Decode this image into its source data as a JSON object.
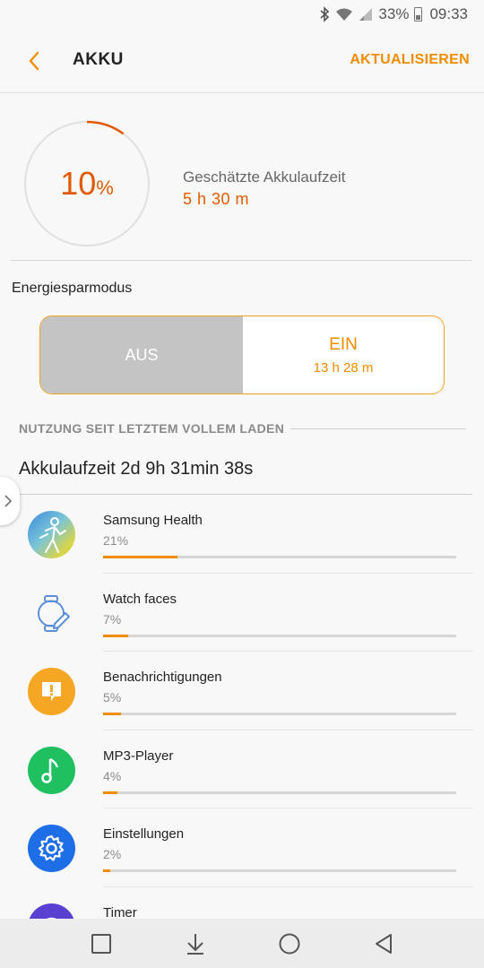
{
  "status": {
    "battery_percent": "33%",
    "time": "09:33",
    "icons": [
      "bluetooth-icon",
      "wifi-icon",
      "signal-icon",
      "battery-icon"
    ]
  },
  "header": {
    "title": "AKKU",
    "refresh_label": "AKTUALISIEREN"
  },
  "battery": {
    "level_number": "10",
    "level_unit": "%",
    "level_fraction": 0.1,
    "estimate_label": "Geschätzte Akkulaufzeit",
    "estimate_value": "5 h 30 m"
  },
  "power_saving": {
    "label": "Energiesparmodus",
    "off_label": "AUS",
    "on_label": "EIN",
    "on_time": "13 h 28 m"
  },
  "usage": {
    "section_title": "NUTZUNG SEIT LETZTEM VOLLEM LADEN",
    "uptime": "Akkulaufzeit 2d 9h 31min 38s",
    "apps": [
      {
        "name": "Samsung Health",
        "percent": "21%",
        "fraction": 0.21,
        "icon": "samsung-health-icon"
      },
      {
        "name": "Watch faces",
        "percent": "7%",
        "fraction": 0.07,
        "icon": "watch-faces-icon"
      },
      {
        "name": "Benachrichtigungen",
        "percent": "5%",
        "fraction": 0.05,
        "icon": "notification-icon"
      },
      {
        "name": "MP3-Player",
        "percent": "4%",
        "fraction": 0.04,
        "icon": "music-note-icon"
      },
      {
        "name": "Einstellungen",
        "percent": "2%",
        "fraction": 0.02,
        "icon": "settings-gear-icon"
      },
      {
        "name": "Timer",
        "percent": "",
        "fraction": 0,
        "icon": "timer-icon"
      }
    ]
  },
  "colors": {
    "accent": "#f08c00",
    "battery_text": "#e25a00",
    "off_bg": "#c4c4c4"
  }
}
